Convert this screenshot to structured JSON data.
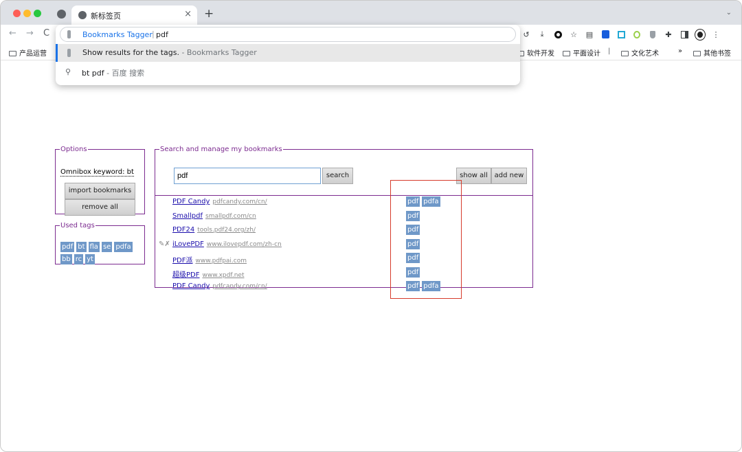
{
  "browser": {
    "tab_title": "新标签页",
    "tab_close": "×",
    "new_tab": "+",
    "tab_menu": "⌄",
    "nav": {
      "back": "←",
      "forward": "→",
      "reload": "C"
    },
    "menu": "⋮"
  },
  "omnibox": {
    "keyword": "Bookmarks Tagger",
    "separator": "|",
    "query": "pdf",
    "suggestions": [
      {
        "main": "Show results for the tags.",
        "sub": " - Bookmarks Tagger"
      },
      {
        "main": "bt pdf",
        "sub": " - 百度 搜索"
      }
    ]
  },
  "bookmarks_bar": {
    "items": [
      "产品运营",
      "软件开发",
      "平面设计",
      "文化艺术"
    ],
    "more": "»",
    "other": "其他书签",
    "separator": "|"
  },
  "options": {
    "legend": "Options",
    "keyword_label": "Omnibox keyword: bt",
    "import_button": "import bookmarks",
    "remove_button": "remove all"
  },
  "used_tags": {
    "legend": "Used tags",
    "tags": [
      "pdf",
      "bt",
      "fla",
      "se",
      "pdfa",
      "bb",
      "rc",
      "yt"
    ]
  },
  "main": {
    "legend": "Search and manage my bookmarks",
    "search_value": "pdf",
    "search_button": "search",
    "show_all_button": "show all",
    "add_new_button": "add new",
    "edit_icons": "✎✗",
    "rows": [
      {
        "title": "PDF Candy",
        "url": "pdfcandy.com/cn/",
        "tags": [
          "pdf",
          "pdfa"
        ]
      },
      {
        "title": "Smallpdf",
        "url": "smallpdf.com/cn",
        "tags": [
          "pdf"
        ]
      },
      {
        "title": "PDF24",
        "url": "tools.pdf24.org/zh/",
        "tags": [
          "pdf"
        ]
      },
      {
        "title": "iLovePDF",
        "url": "www.ilovepdf.com/zh-cn",
        "tags": [
          "pdf"
        ]
      },
      {
        "title": "PDF派",
        "url": "www.pdfpai.com",
        "tags": [
          "pdf"
        ]
      },
      {
        "title": "超级PDF",
        "url": "www.xpdf.net",
        "tags": [
          "pdf"
        ]
      },
      {
        "title": "PDF Candy",
        "url": "pdfcandy.com/cn/",
        "tags": [
          "pdf",
          "pdfa"
        ]
      }
    ]
  }
}
